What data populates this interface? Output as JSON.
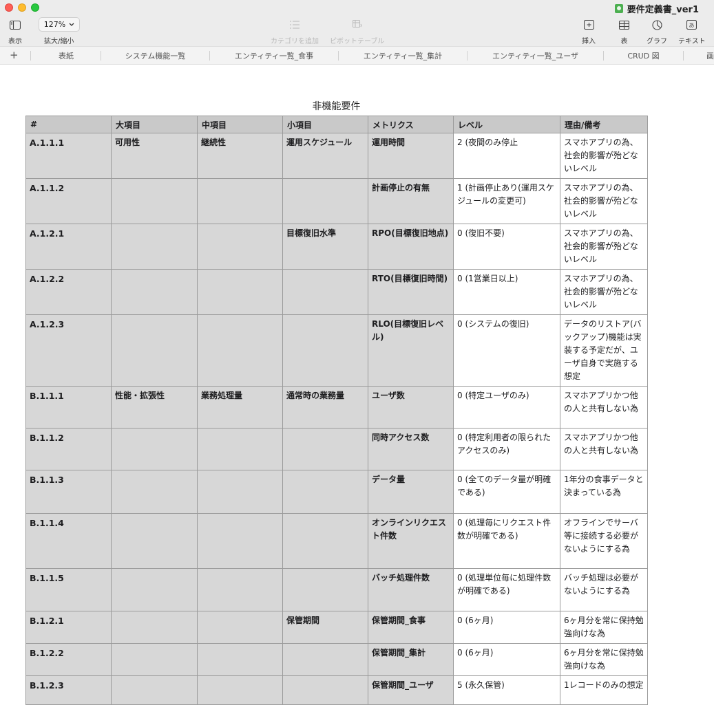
{
  "window": {
    "doc_title": "要件定義書_ver1"
  },
  "toolbar": {
    "view_label": "表示",
    "zoom_value": "127%",
    "zoom_label": "拡大/縮小",
    "add_category_label": "カテゴリを追加",
    "pivot_label": "ピボットテーブル",
    "insert_label": "挿入",
    "table_label": "表",
    "chart_label": "グラフ",
    "text_label": "テキスト"
  },
  "tabs": [
    "表紙",
    "システム機能一覧",
    "エンティティ一覧_食事",
    "エンティティ一覧_集計",
    "エンティティ一覧_ユーザ",
    "CRUD 図",
    "画"
  ],
  "sheet": {
    "title": "非機能要件",
    "headers": [
      "#",
      "大項目",
      "中項目",
      "小項目",
      "メトリクス",
      "レベル",
      "理由/備考"
    ],
    "rows": [
      [
        "A.1.1.1",
        "可用性",
        "継続性",
        "運用スケジュール",
        "運用時間",
        "2 (夜間のみ停止",
        "スマホアプリの為、社会的影響が殆どないレベル"
      ],
      [
        "A.1.1.2",
        "",
        "",
        "",
        "計画停止の有無",
        "1 (計画停止あり(運用スケジュールの変更可)",
        "スマホアプリの為、社会的影響が殆どないレベル"
      ],
      [
        "A.1.2.1",
        "",
        "",
        "目標復旧水準",
        "RPO(目標復旧地点)",
        "0 (復旧不要)",
        "スマホアプリの為、社会的影響が殆どないレベル"
      ],
      [
        "A.1.2.2",
        "",
        "",
        "",
        "RTO(目標復旧時間)",
        "0 (1営業日以上)",
        "スマホアプリの為、社会的影響が殆どないレベル"
      ],
      [
        "A.1.2.3",
        "",
        "",
        "",
        "RLO(目標復旧レベル)",
        "0 (システムの復旧)",
        "データのリストア(バックアップ)機能は実装する予定だが、ユーザ自身で実施する想定"
      ],
      [
        "B.1.1.1",
        "性能・拡張性",
        "業務処理量",
        "通常時の業務量",
        "ユーザ数",
        "0 (特定ユーザのみ)",
        "スマホアプリかつ他の人と共有しない為"
      ],
      [
        "B.1.1.2",
        "",
        "",
        "",
        "同時アクセス数",
        "0 (特定利用者の限られたアクセスのみ)",
        "スマホアプリかつ他の人と共有しない為"
      ],
      [
        "B.1.1.3",
        "",
        "",
        "",
        "データ量",
        "0 (全てのデータ量が明確である)",
        "1年分の食事データと決まっている為"
      ],
      [
        "B.1.1.4",
        "",
        "",
        "",
        "オンラインリクエスト件数",
        "0 (処理毎にリクエスト件数が明確である)",
        "オフラインでサーバ等に接続する必要がないようにする為"
      ],
      [
        "B.1.1.5",
        "",
        "",
        "",
        "バッチ処理件数",
        "0 (処理単位毎に処理件数が明確である)",
        "バッチ処理は必要がないようにする為"
      ],
      [
        "B.1.2.1",
        "",
        "",
        "保管期間",
        "保管期間_食事",
        "0 (6ヶ月)",
        "6ヶ月分を常に保持勉強向けな為"
      ],
      [
        "B.1.2.2",
        "",
        "",
        "",
        "保管期間_集計",
        "0 (6ヶ月)",
        "6ヶ月分を常に保持勉強向けな為"
      ],
      [
        "B.1.2.3",
        "",
        "",
        "",
        "保管期間_ユーザ",
        "5 (永久保管)",
        "1レコードのみの想定"
      ]
    ]
  }
}
